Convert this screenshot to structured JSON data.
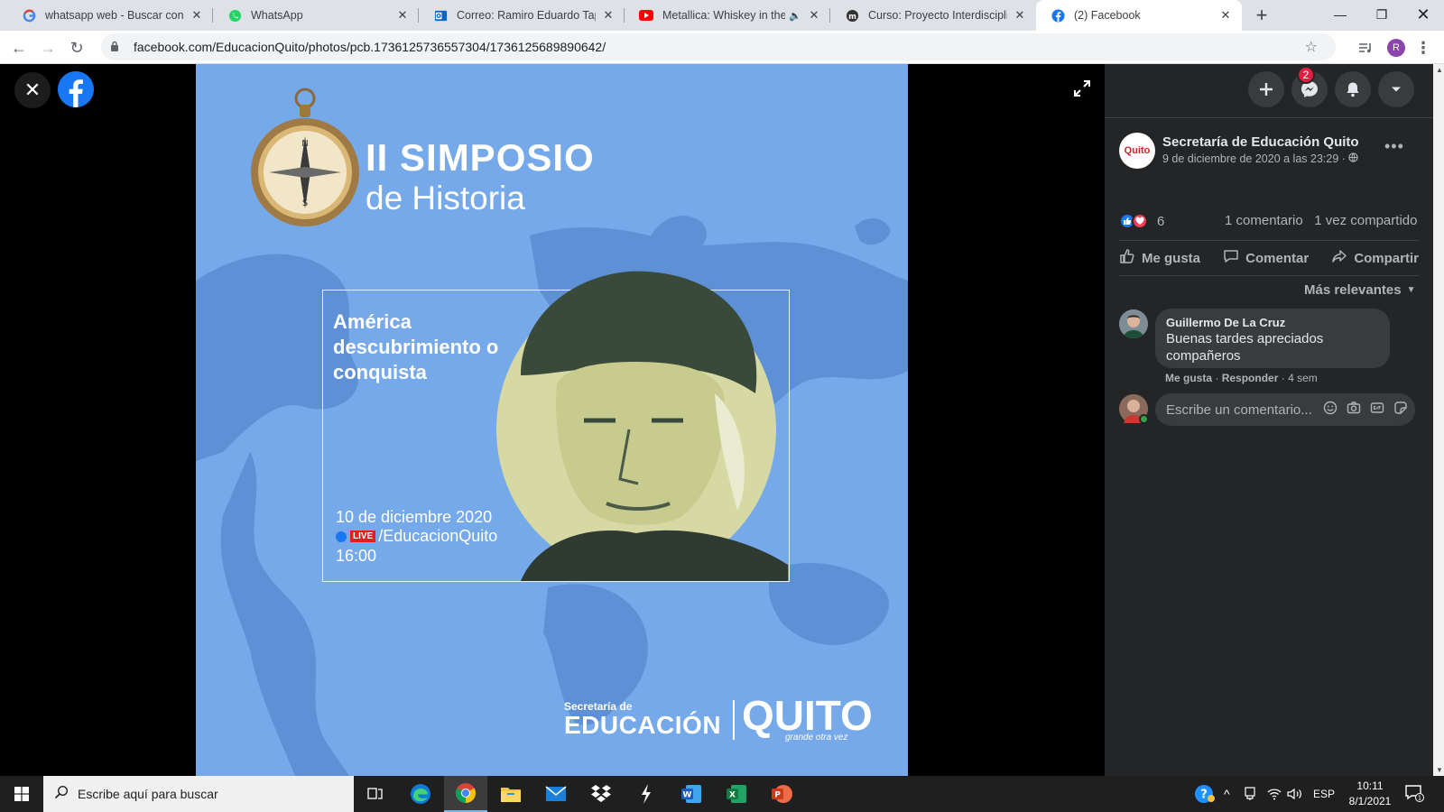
{
  "browser": {
    "tabs": [
      {
        "title": "whatsapp web - Buscar con Google",
        "favicon": "google-icon"
      },
      {
        "title": "WhatsApp",
        "favicon": "whatsapp-icon"
      },
      {
        "title": "Correo: Ramiro Eduardo Tapia",
        "favicon": "outlook-icon"
      },
      {
        "title": "Metallica: Whiskey in the Jar",
        "favicon": "youtube-icon"
      },
      {
        "title": "Curso: Proyecto Interdisciplinar",
        "favicon": "moodle-icon"
      },
      {
        "title": "(2) Facebook",
        "favicon": "facebook-icon"
      }
    ],
    "url": "facebook.com/EducacionQuito/photos/pcb.1736125736557304/1736125689890642/",
    "profile_initial": "R"
  },
  "poster": {
    "title_line1": "II SIMPOSIO",
    "title_line2": "de Historia",
    "question": "América descubrimiento o conquista",
    "date": "10 de diciembre 2020",
    "live_label": "LIVE",
    "handle": "/EducacionQuito",
    "time": "16:00",
    "brand_small": "Secretaría de",
    "brand_big": "EDUCACIÓN",
    "brand_quito": "QUITO",
    "brand_tagline": "grande otra vez"
  },
  "header": {
    "messenger_badge": "2"
  },
  "post": {
    "page_avatar_text": "Quito",
    "page_name": "Secretaría de Educación Quito",
    "date": "9 de diciembre de 2020 a las 23:29 ·",
    "reaction_count": "6",
    "comments_count": "1 comentario",
    "shares_count": "1 vez compartido",
    "actions": {
      "like": "Me gusta",
      "comment": "Comentar",
      "share": "Compartir"
    },
    "sort_label": "Más relevantes"
  },
  "comment": {
    "author": "Guillermo De La Cruz",
    "text": "Buenas tardes apreciados compañeros",
    "like_label": "Me gusta",
    "reply_label": "Responder",
    "age": "4 sem"
  },
  "composer": {
    "placeholder": "Escribe un comentario..."
  },
  "taskbar": {
    "search_placeholder": "Escribe aquí para buscar",
    "language": "ESP",
    "time": "10:11",
    "date": "8/1/2021",
    "notif_count": "1"
  }
}
